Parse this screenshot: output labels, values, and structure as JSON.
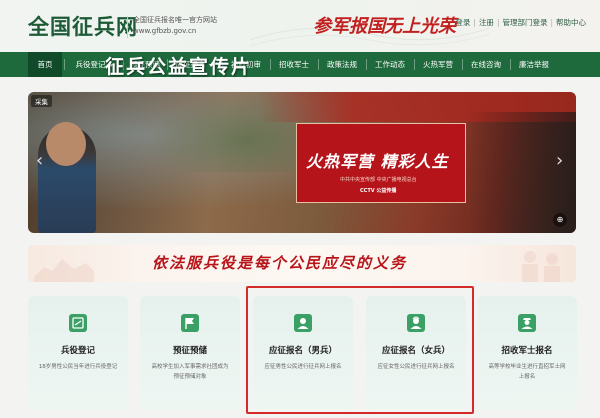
{
  "header": {
    "logo": "全国征兵网",
    "logo_sub1": "全国征兵报名唯一官方网站",
    "logo_sub2": "www.gfbzb.gov.cn",
    "slogan1": "参军报国",
    "slogan2": "无上光荣",
    "links": [
      "登录",
      "注册",
      "管理部门登录",
      "帮助中心"
    ]
  },
  "nav": {
    "items": [
      "首页",
      "兵役登记",
      "预征预储",
      "应征报名",
      "初检初审",
      "招收军士",
      "政策法规",
      "工作动态",
      "火热军营",
      "在线咨询",
      "廉洁举报"
    ]
  },
  "banner": {
    "ad_tag": "采集",
    "title": "征兵公益宣传片",
    "red_title": "火热军营 精彩人生",
    "red_sub": "中共中央宣传部  中央广播电视总台",
    "red_cctv": "CCTV   公益传播",
    "prev": "‹",
    "next": "›",
    "share": "⊕"
  },
  "strip": {
    "text": "依法服兵役是每个公民应尽的义务"
  },
  "cards": [
    {
      "title": "兵役登记",
      "desc": "18岁男性公民当年进行兵役登记",
      "icon": "id-card-icon"
    },
    {
      "title": "预征预储",
      "desc": "高校学生加入军事需求社团成为预征预储对象",
      "icon": "flag-icon"
    },
    {
      "title": "应征报名（男兵）",
      "desc": "应征男性公民进行征兵网上报名",
      "icon": "male-user-icon"
    },
    {
      "title": "应征报名（女兵）",
      "desc": "应征女性公民进行征兵网上报名",
      "icon": "female-user-icon"
    },
    {
      "title": "招收军士报名",
      "desc": "高等学校毕业生进行直招军士网上报名",
      "icon": "soldier-icon"
    }
  ],
  "colors": {
    "brand_green": "#1e6a3d",
    "accent_red": "#c21f1f",
    "card_icon": "#3aa066"
  }
}
